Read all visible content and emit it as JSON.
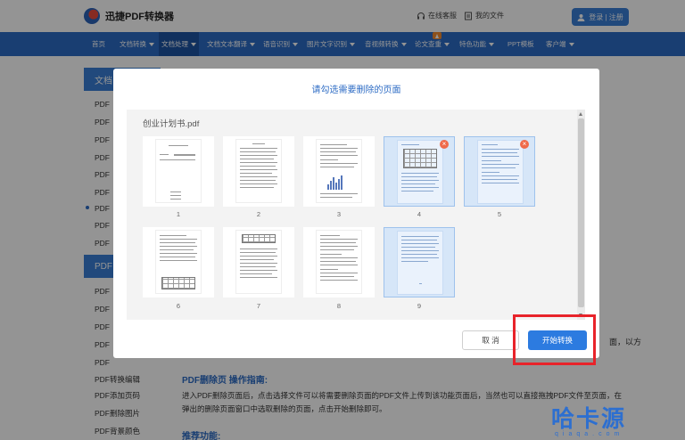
{
  "header": {
    "app_name": "迅捷PDF转换器",
    "service_link": "在线客服",
    "files_link": "我的文件",
    "login_label": "登录 | 注册"
  },
  "nav": {
    "items": [
      {
        "label": "首页",
        "dropdown": false
      },
      {
        "label": "文档转换",
        "dropdown": true
      },
      {
        "label": "文档处理",
        "dropdown": true
      },
      {
        "label": "文档文本翻译",
        "dropdown": true
      },
      {
        "label": "语音识别",
        "dropdown": true
      },
      {
        "label": "图片文字识别",
        "dropdown": true
      },
      {
        "label": "音视频转换",
        "dropdown": true
      },
      {
        "label": "论文查重",
        "dropdown": true
      },
      {
        "label": "特色功能",
        "dropdown": true
      },
      {
        "label": "PPT模板",
        "dropdown": false
      },
      {
        "label": "客户端",
        "dropdown": true
      }
    ],
    "active_index": 2
  },
  "sidebar": {
    "heading1": "文档",
    "heading2": "PDF",
    "items_top": [
      "PDF",
      "PDF",
      "PDF",
      "PDF",
      "PDF",
      "PDF",
      "PDF",
      "PDF",
      "PDF"
    ],
    "items_bottom": [
      "PDF",
      "PDF",
      "PDF",
      "PDF",
      "PDF",
      "PDF转换编辑",
      "PDF添加页码",
      "PDF删除图片",
      "PDF背景颜色"
    ]
  },
  "background": {
    "section1_title": "PDF删除页 操作指南:",
    "paragraph": "进入PDF删除页面后，点击选择文件可以将需要删除页面的PDF文件上传到该功能页面后，当然也可以直接拖拽PDF文件至页面，在弹出的删除页面窗口中选取删除的页面，点击开始删除即可。",
    "section2_title": "推荐功能:",
    "right_fragment": "面，以方"
  },
  "modal": {
    "title": "请勾选需要删除的页面",
    "file_name": "创业计划书.pdf",
    "pages": [
      {
        "number": "1",
        "selected": false
      },
      {
        "number": "2",
        "selected": false
      },
      {
        "number": "3",
        "selected": false
      },
      {
        "number": "4",
        "selected": true
      },
      {
        "number": "5",
        "selected": true
      },
      {
        "number": "6",
        "selected": false
      },
      {
        "number": "7",
        "selected": false
      },
      {
        "number": "8",
        "selected": false
      },
      {
        "number": "9",
        "selected": true
      }
    ],
    "cancel_label": "取 消",
    "start_label": "开始转换"
  },
  "watermark": {
    "main": "哈卡源",
    "sub": "qiaqa.com"
  },
  "colors": {
    "brand_blue": "#2c6bc4",
    "highlight_red": "#e8232a",
    "delete_badge": "#ef6a4a"
  }
}
